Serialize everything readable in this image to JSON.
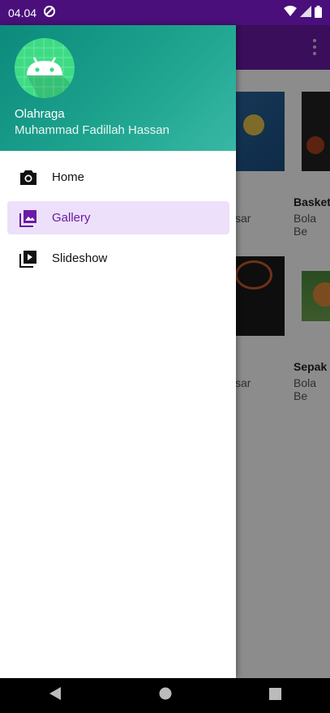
{
  "status_bar": {
    "time": "04.04"
  },
  "drawer": {
    "header": {
      "title": "Olahraga",
      "subtitle": "Muhammad Fadillah Hassan"
    },
    "items": [
      {
        "label": "Home",
        "icon": "camera-icon",
        "selected": false
      },
      {
        "label": "Gallery",
        "icon": "gallery-icon",
        "selected": true
      },
      {
        "label": "Slideshow",
        "icon": "slideshow-icon",
        "selected": false
      }
    ]
  },
  "background_cards": [
    {
      "title": "Basket",
      "subtitle": "Bola Be"
    },
    {
      "title": "Sepak",
      "subtitle": "Bola Be"
    }
  ],
  "background_partial": [
    "sar",
    "sar"
  ],
  "colors": {
    "primary": "#6a1aa6",
    "header_teal": "#1fa590",
    "selected_bg": "#ede0fa"
  }
}
